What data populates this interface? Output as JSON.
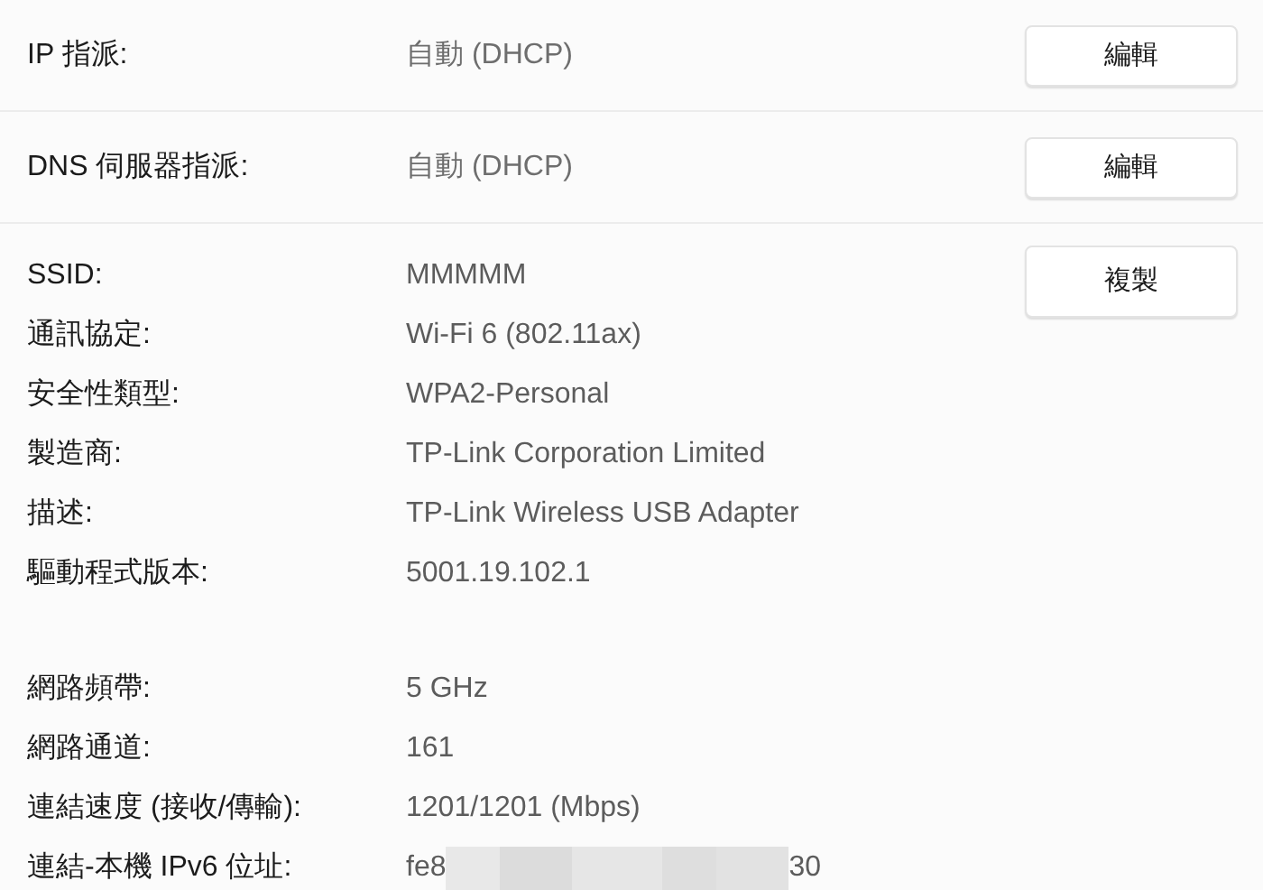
{
  "assignments": [
    {
      "label": "IP 指派:",
      "value": "自動 (DHCP)",
      "button": "編輯"
    },
    {
      "label": "DNS 伺服器指派:",
      "value": "自動 (DHCP)",
      "button": "編輯"
    }
  ],
  "details": {
    "button": "複製",
    "groups": [
      {
        "rows": [
          {
            "label": "SSID:",
            "value": "MMMMM"
          },
          {
            "label": "通訊協定:",
            "value": "Wi-Fi 6 (802.11ax)"
          },
          {
            "label": "安全性類型:",
            "value": "WPA2-Personal"
          },
          {
            "label": "製造商:",
            "value": "TP-Link Corporation Limited"
          },
          {
            "label": "描述:",
            "value": "TP-Link Wireless USB Adapter"
          },
          {
            "label": "驅動程式版本:",
            "value": "5001.19.102.1"
          }
        ]
      },
      {
        "rows": [
          {
            "label": "網路頻帶:",
            "value": "5 GHz"
          },
          {
            "label": "網路通道:",
            "value": "161"
          },
          {
            "label": "連結速度 (接收/傳輸):",
            "value": "1201/1201 (Mbps)"
          },
          {
            "label": "連結-本機 IPv6 位址:",
            "value": "fe8",
            "value_end": "30"
          }
        ]
      }
    ]
  }
}
